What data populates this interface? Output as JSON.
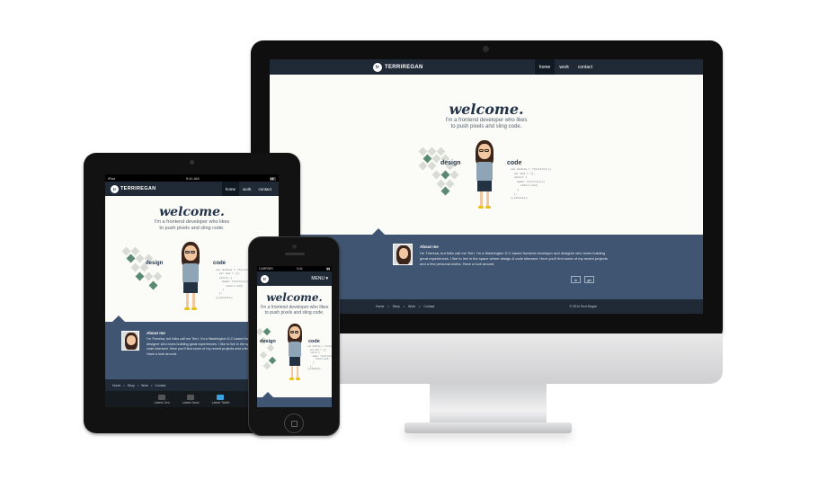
{
  "site": {
    "brand": "TERRIREGAN",
    "logo": "tr",
    "nav": [
      "home",
      "work",
      "contact"
    ],
    "mobile_menu": "MENU",
    "welcome": "welcome.",
    "tagline_1": "I'm a frontend developer who likes",
    "tagline_2": "to push pixels and sling code.",
    "design_label": "design",
    "code_label": "code",
    "code_snippet": "var module = (function(){\n  var mod = {};\n  return {\n    make: function(){\n      return mod;\n    }\n  };\n})(module);",
    "about_title": "About me",
    "about_text": "I'm Theresa, but folks call me Terri. I'm a Washington D.C based frontend developer and designer who loves building great experiences. I like to live in the space where design & code intersect. Here you'll find some of my recent projects and a few personal works. Have a look around.",
    "social": [
      "in",
      "gh"
    ],
    "footer_links": [
      "Home",
      "Story",
      "Work",
      "Contact"
    ],
    "copyright": "© 2014 Terri Regan"
  },
  "ipad": {
    "carrier": "iPad",
    "time": "9:41 AM",
    "about_text": "I'm Theresa, but folks call me Terri. I'm a Washington D.C based frontend developer and designer who loves building great experiences. I like to live in the space where design & code intersect. Here you'll find some of my recent projects and a few personal works. Have a look around.",
    "tabs": [
      "Latest Gen",
      "Latest Nano",
      "Latest Tablet"
    ]
  },
  "iphone": {
    "carrier": "CARRIER",
    "time": "9:41"
  },
  "colors": {
    "navy": "#1f2a36",
    "slate": "#3f5571",
    "accent_green": "#5b8a72",
    "tile_light": "#d8dcd5",
    "text_dark": "#23344a"
  }
}
